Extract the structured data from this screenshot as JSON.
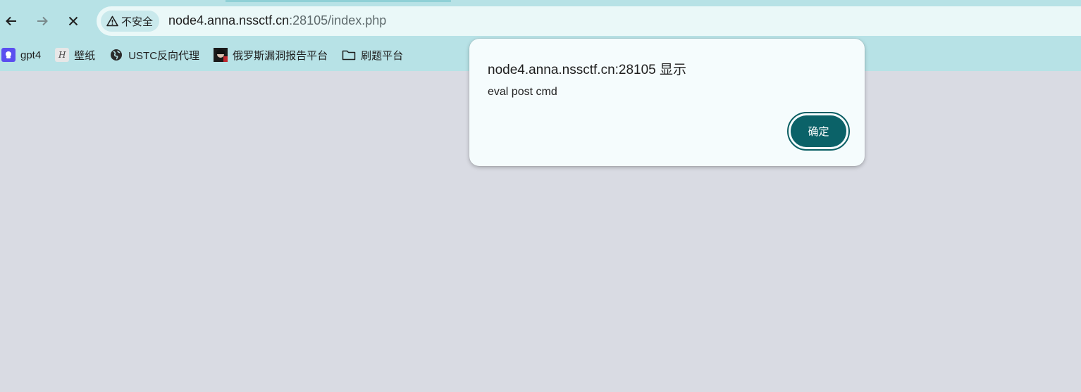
{
  "browser": {
    "nav": {
      "back_icon": "back-arrow-icon",
      "forward_icon": "forward-arrow-icon",
      "stop_icon": "close-icon"
    },
    "omnibox": {
      "security_label": "不安全",
      "url_host": "node4.anna.nssctf.cn",
      "url_rest": ":28105/index.php"
    },
    "bookmarks": [
      {
        "label": "gpt4",
        "icon": "gpt-icon"
      },
      {
        "label": "壁纸",
        "icon": "wallpaper-icon"
      },
      {
        "label": "USTC反向代理",
        "icon": "globe-icon"
      },
      {
        "label": "俄罗斯漏洞报告平台",
        "icon": "avatar-icon"
      },
      {
        "label": "刷题平台",
        "icon": "folder-icon"
      }
    ]
  },
  "dialog": {
    "title": "node4.anna.nssctf.cn:28105 显示",
    "message": "eval post cmd",
    "ok_label": "确定"
  },
  "colors": {
    "chrome": "#b7e2e6",
    "omnibox": "#eaf8f8",
    "page": "#d9dbe3",
    "dialog": "#f5fcfd",
    "button": "#0b6268"
  }
}
